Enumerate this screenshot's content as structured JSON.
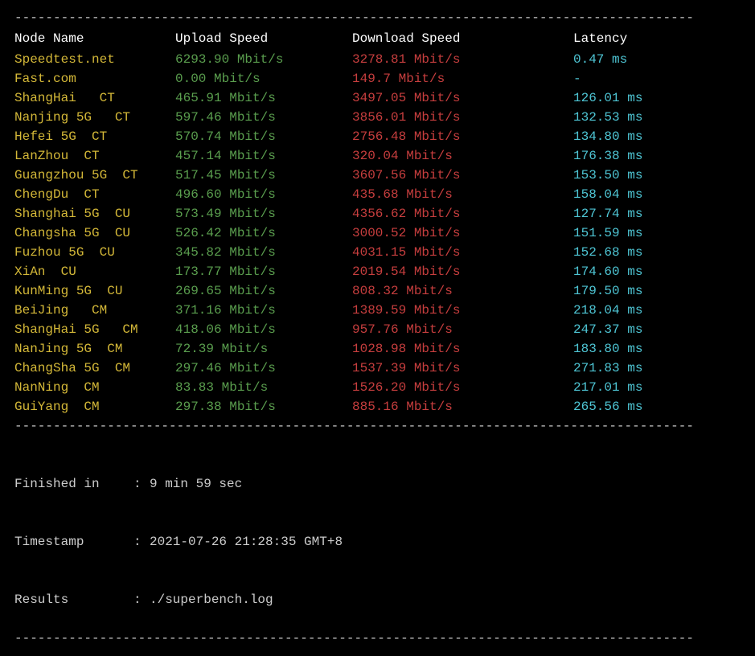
{
  "divider": "----------------------------------------------------------------------------------------",
  "headers": {
    "node": "Node Name",
    "upload": "Upload Speed",
    "download": "Download Speed",
    "latency": "Latency"
  },
  "rows": [
    {
      "node": "Speedtest.net",
      "isp": "",
      "upload": "6293.90 Mbit/s",
      "download": "3278.81 Mbit/s",
      "latency": "0.47 ms"
    },
    {
      "node": "Fast.com",
      "isp": "",
      "upload": "0.00 Mbit/s",
      "download": "149.7 Mbit/s",
      "latency": "-"
    },
    {
      "node": "ShangHai   ",
      "isp": "CT",
      "upload": "465.91 Mbit/s",
      "download": "3497.05 Mbit/s",
      "latency": "126.01 ms"
    },
    {
      "node": "Nanjing 5G   ",
      "isp": "CT",
      "upload": "597.46 Mbit/s",
      "download": "3856.01 Mbit/s",
      "latency": "132.53 ms"
    },
    {
      "node": "Hefei 5G  ",
      "isp": "CT",
      "upload": "570.74 Mbit/s",
      "download": "2756.48 Mbit/s",
      "latency": "134.80 ms"
    },
    {
      "node": "LanZhou  ",
      "isp": "CT",
      "upload": "457.14 Mbit/s",
      "download": "320.04 Mbit/s",
      "latency": "176.38 ms"
    },
    {
      "node": "Guangzhou 5G  ",
      "isp": "CT",
      "upload": "517.45 Mbit/s",
      "download": "3607.56 Mbit/s",
      "latency": "153.50 ms"
    },
    {
      "node": "ChengDu  ",
      "isp": "CT",
      "upload": "496.60 Mbit/s",
      "download": "435.68 Mbit/s",
      "latency": "158.04 ms"
    },
    {
      "node": "Shanghai 5G  ",
      "isp": "CU",
      "upload": "573.49 Mbit/s",
      "download": "4356.62 Mbit/s",
      "latency": "127.74 ms"
    },
    {
      "node": "Changsha 5G  ",
      "isp": "CU",
      "upload": "526.42 Mbit/s",
      "download": "3000.52 Mbit/s",
      "latency": "151.59 ms"
    },
    {
      "node": "Fuzhou 5G  ",
      "isp": "CU",
      "upload": "345.82 Mbit/s",
      "download": "4031.15 Mbit/s",
      "latency": "152.68 ms"
    },
    {
      "node": "XiAn  ",
      "isp": "CU",
      "upload": "173.77 Mbit/s",
      "download": "2019.54 Mbit/s",
      "latency": "174.60 ms"
    },
    {
      "node": "KunMing 5G  ",
      "isp": "CU",
      "upload": "269.65 Mbit/s",
      "download": "808.32 Mbit/s",
      "latency": "179.50 ms"
    },
    {
      "node": "BeiJing   ",
      "isp": "CM",
      "upload": "371.16 Mbit/s",
      "download": "1389.59 Mbit/s",
      "latency": "218.04 ms"
    },
    {
      "node": "ShangHai 5G   ",
      "isp": "CM",
      "upload": "418.06 Mbit/s",
      "download": "957.76 Mbit/s",
      "latency": "247.37 ms"
    },
    {
      "node": "NanJing 5G  ",
      "isp": "CM",
      "upload": "72.39 Mbit/s",
      "download": "1028.98 Mbit/s",
      "latency": "183.80 ms"
    },
    {
      "node": "ChangSha 5G  ",
      "isp": "CM",
      "upload": "297.46 Mbit/s",
      "download": "1537.39 Mbit/s",
      "latency": "271.83 ms"
    },
    {
      "node": "NanNing  ",
      "isp": "CM",
      "upload": "83.83 Mbit/s",
      "download": "1526.20 Mbit/s",
      "latency": "217.01 ms"
    },
    {
      "node": "GuiYang  ",
      "isp": "CM",
      "upload": "297.38 Mbit/s",
      "download": "885.16 Mbit/s",
      "latency": "265.56 ms"
    }
  ],
  "footer": {
    "finished_label": "Finished in",
    "finished_value": "9 min 59 sec",
    "timestamp_label": "Timestamp",
    "timestamp_value": "2021-07-26 21:28:35 GMT+8",
    "results_label": "Results",
    "results_value": "./superbench.log",
    "sep": ":"
  }
}
